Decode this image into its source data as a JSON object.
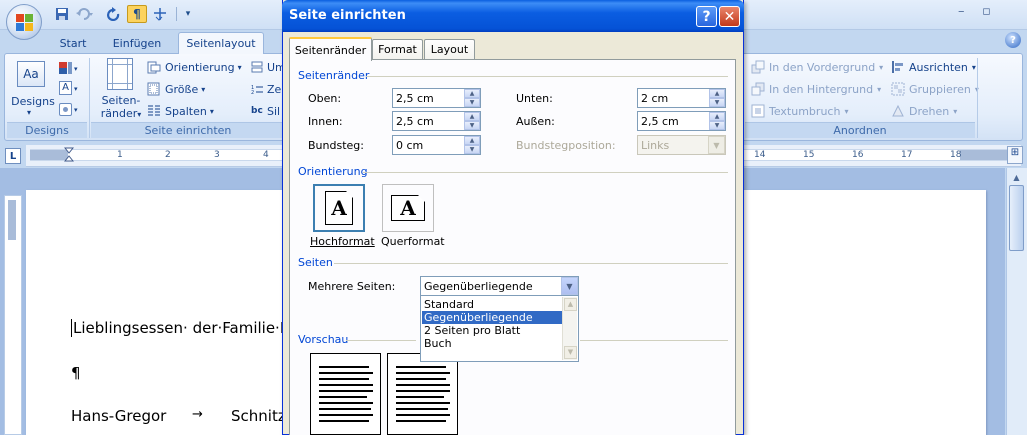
{
  "quick_access": {
    "title_right": "",
    "window_buttons": [
      "–",
      "▫"
    ]
  },
  "tabs": [
    {
      "label": "Start"
    },
    {
      "label": "Einfügen"
    },
    {
      "label": "Seitenlayout"
    }
  ],
  "help_label": "?",
  "ribbon": {
    "designs": {
      "button_label": "Designs",
      "group_label": "Designs"
    },
    "seite_einrichten": {
      "seitenraender_label_1": "Seiten-",
      "seitenraender_label_2": "ränder",
      "orientierung": "Orientierung",
      "groesse": "Größe",
      "spalten": "Spalten",
      "um_fragment": "Um",
      "zei_fragment": "Zei",
      "sil_fragment": "Sil",
      "group_label": "Seite einrichten"
    },
    "anordnen": {
      "vordergrund": "In den Vordergrund",
      "hintergrund": "In den Hintergrund",
      "textumbruch": "Textumbruch",
      "ausrichten": "Ausrichten",
      "gruppieren": "Gruppieren",
      "drehen": "Drehen",
      "group_label": "Anordnen"
    }
  },
  "ruler": {
    "corner": "L",
    "numbers_left": [
      "1",
      "2",
      "3",
      "4"
    ],
    "numbers_right": [
      "14",
      "15",
      "16",
      "17",
      "18"
    ]
  },
  "document": {
    "line1": "Lieblingsessen· der·Familie·M",
    "line2": "¶",
    "line3_name": "Hans-Gregor",
    "line3_arrow": "→",
    "line3_rest": "Schnitz"
  },
  "dialog": {
    "title": "Seite einrichten",
    "help_button": "?",
    "close_button": "✕",
    "tabs": [
      "Seitenränder",
      "Format",
      "Layout"
    ],
    "margins_section": "Seitenränder",
    "oben_label": "Oben:",
    "oben_value": "2,5 cm",
    "unten_label": "Unten:",
    "unten_value": "2 cm",
    "innen_label": "Innen:",
    "innen_value": "2,5 cm",
    "aussen_label": "Außen:",
    "aussen_value": "2,5 cm",
    "bundsteg_label": "Bundsteg:",
    "bundsteg_value": "0 cm",
    "bundstegposition_label": "Bundstegposition:",
    "bundstegposition_value": "Links",
    "orientation_section": "Orientierung",
    "hochformat": "Hochformat",
    "querformat": "Querformat",
    "pages_section": "Seiten",
    "mehrere_seiten_label": "Mehrere Seiten:",
    "mehrere_seiten_value": "Gegenüberliegende Seiten",
    "dropdown_options": [
      "Standard",
      "Gegenüberliegende Seiten",
      "2 Seiten pro Blatt",
      "Buch"
    ],
    "dropdown_selected_index": 1,
    "preview_section": "Vorschau"
  },
  "colors": {
    "office_logo": [
      "#e2471f",
      "#6bb335",
      "#2e7ad6",
      "#f5b71c"
    ],
    "dialog_title": "#0a5fe0",
    "selection": "#316ac5"
  }
}
